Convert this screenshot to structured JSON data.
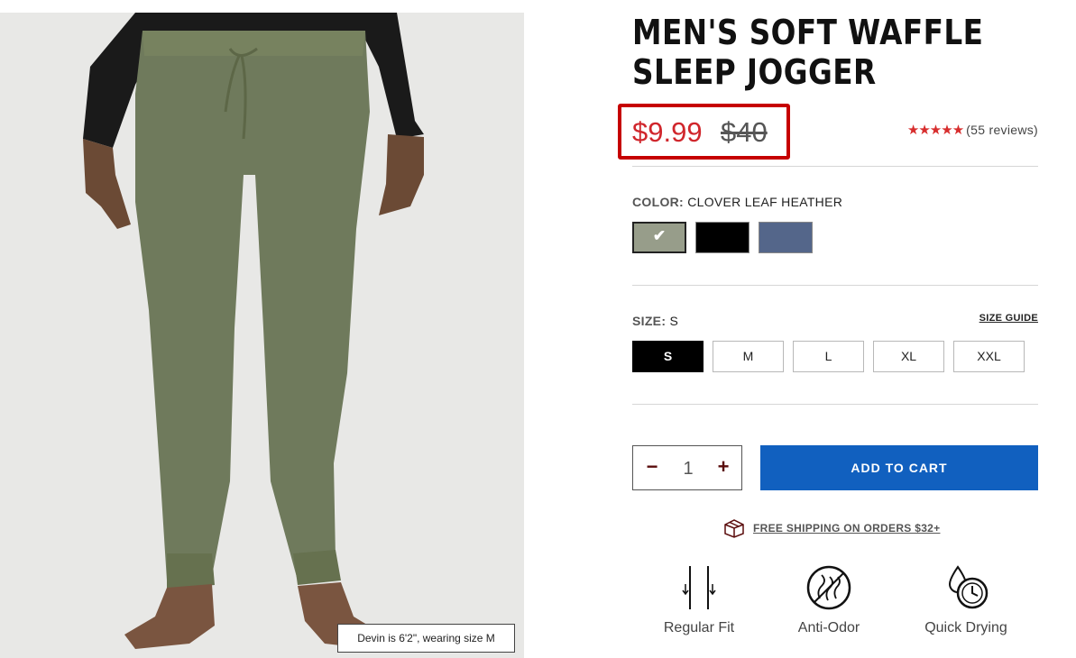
{
  "product": {
    "title": "MEN'S SOFT WAFFLE SLEEP JOGGER",
    "sale_price": "$9.99",
    "original_price": "$40",
    "rating_stars": "★★★★★",
    "rating_value": 5,
    "review_count": "(55 reviews)"
  },
  "image": {
    "caption": "Devin is 6'2\", wearing size M",
    "pants_color": "#6f7a5c",
    "background_color": "#e8e8e6"
  },
  "color": {
    "label": "COLOR:",
    "selected_name": "CLOVER LEAF HEATHER",
    "swatches": [
      {
        "name": "Clover Leaf Heather",
        "hex": "#979d8a",
        "selected": true
      },
      {
        "name": "Black",
        "hex": "#000000",
        "selected": false
      },
      {
        "name": "Blue Heather",
        "hex": "#54668a",
        "selected": false
      }
    ],
    "check_glyph": "✔"
  },
  "size": {
    "label": "SIZE:",
    "selected": "S",
    "guide_label": "SIZE GUIDE",
    "options": [
      "S",
      "M",
      "L",
      "XL",
      "XXL"
    ]
  },
  "cart": {
    "quantity": "1",
    "minus": "−",
    "plus": "+",
    "add_label": "ADD TO CART"
  },
  "shipping": {
    "icon": "box-icon",
    "text": "FREE SHIPPING ON ORDERS $32+"
  },
  "features": [
    {
      "label": "Regular Fit",
      "icon": "regular-fit-icon"
    },
    {
      "label": "Anti-Odor",
      "icon": "anti-odor-icon"
    },
    {
      "label": "Quick Drying",
      "icon": "quick-drying-icon"
    }
  ],
  "colors": {
    "sale_red": "#d0262c",
    "highlight_red": "#c60000",
    "cart_blue": "#1160bf",
    "star_red": "#d72d2d"
  }
}
